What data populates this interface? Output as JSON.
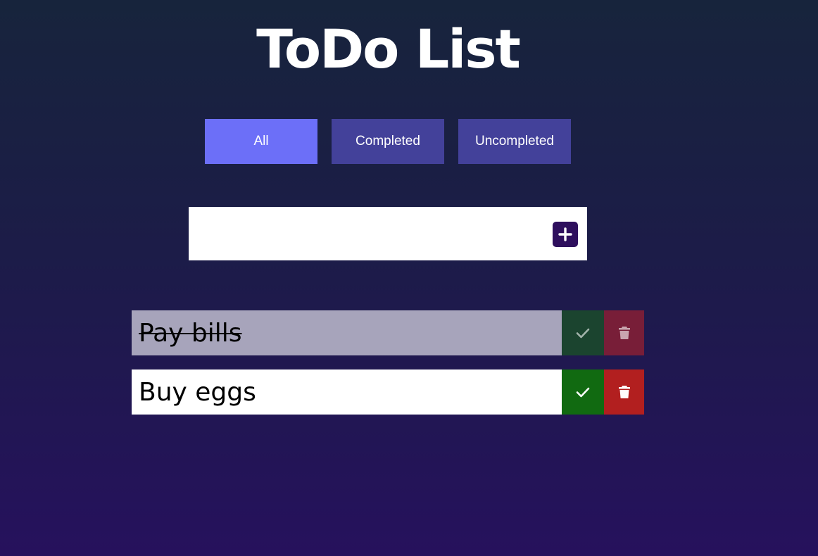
{
  "header": {
    "title": "ToDo List"
  },
  "filters": [
    {
      "label": "All",
      "active": true
    },
    {
      "label": "Completed",
      "active": false
    },
    {
      "label": "Uncompleted",
      "active": false
    }
  ],
  "add_form": {
    "value": "",
    "placeholder": "",
    "button_icon": "plus-icon"
  },
  "todos": [
    {
      "text": "Pay bills",
      "completed": true,
      "check_icon": "check-icon",
      "delete_icon": "trash-icon"
    },
    {
      "text": "Buy eggs",
      "completed": false,
      "check_icon": "check-icon",
      "delete_icon": "trash-icon"
    }
  ],
  "colors": {
    "filter_active": "#6c6ff8",
    "filter_inactive": "#43419a",
    "add_button": "#2e0f5d",
    "complete_button": "#116a11",
    "delete_button": "#b21f1f",
    "completed_item_bg": "#a7a4bb"
  }
}
